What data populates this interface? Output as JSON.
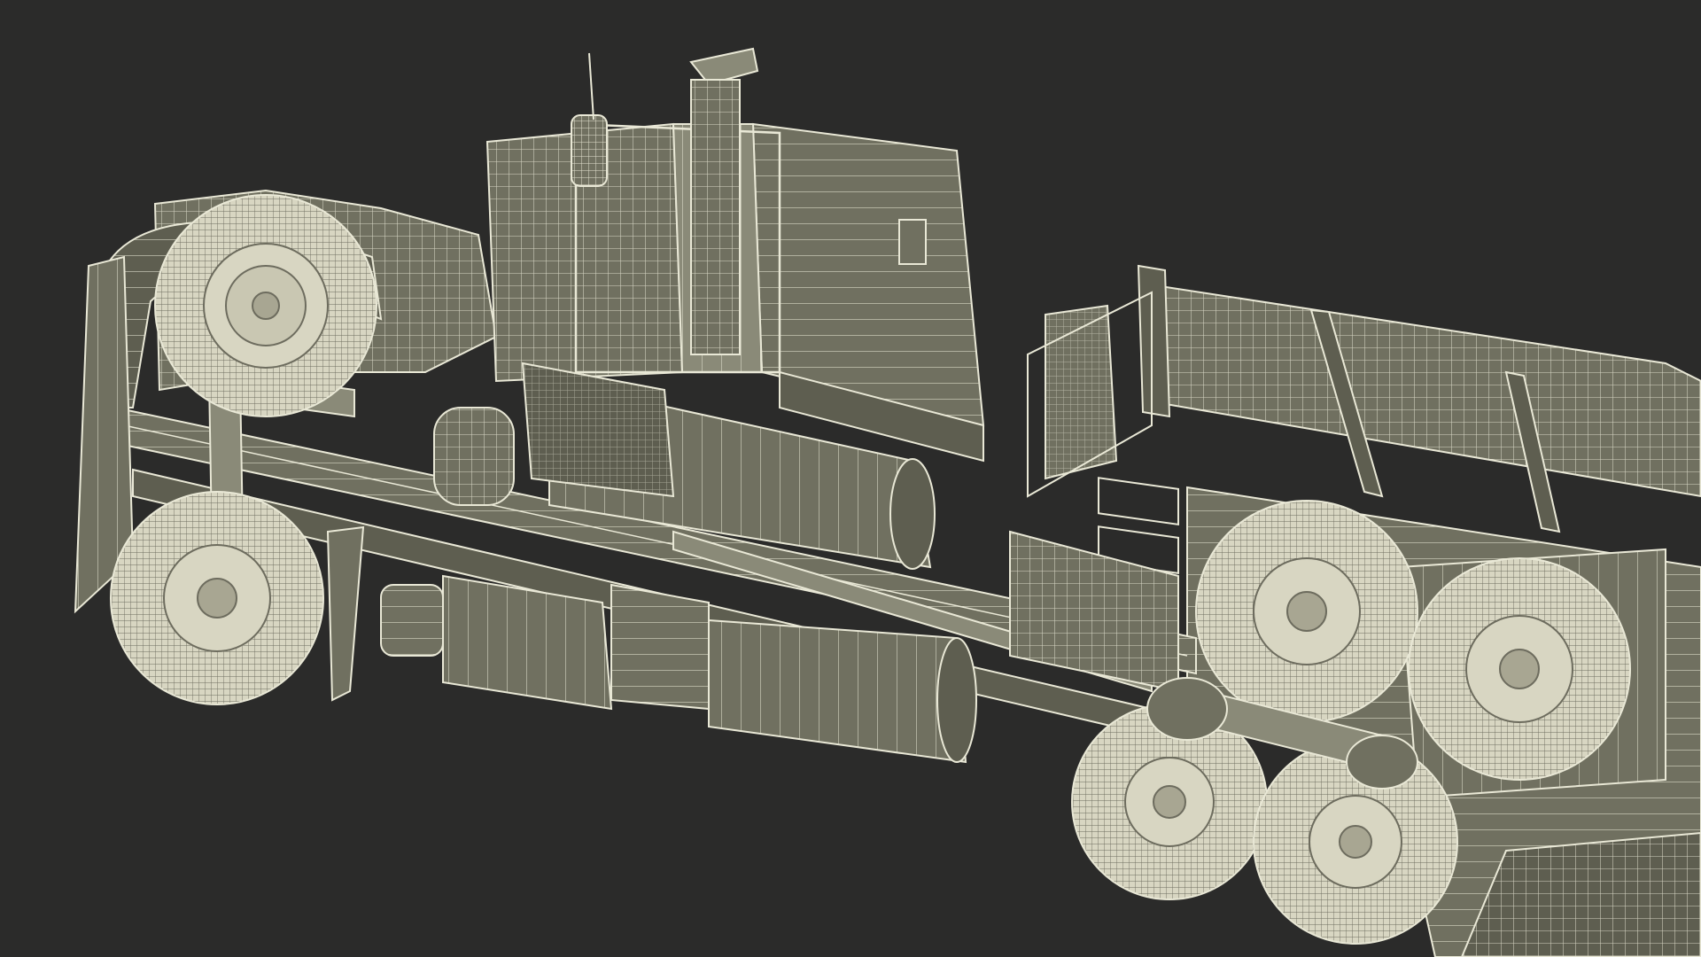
{
  "scene": {
    "subject": "semi-truck-with-car-carrier-trailer",
    "render_style": "wireframe-over-clay",
    "view": "underside-perspective"
  },
  "colors": {
    "background": "#2b2b2a",
    "clay": "#707060",
    "clay_dark": "#5e5e50",
    "clay_light": "#8a8a78",
    "wire": "#e9e8d6",
    "tire": "#d8d6c2"
  }
}
